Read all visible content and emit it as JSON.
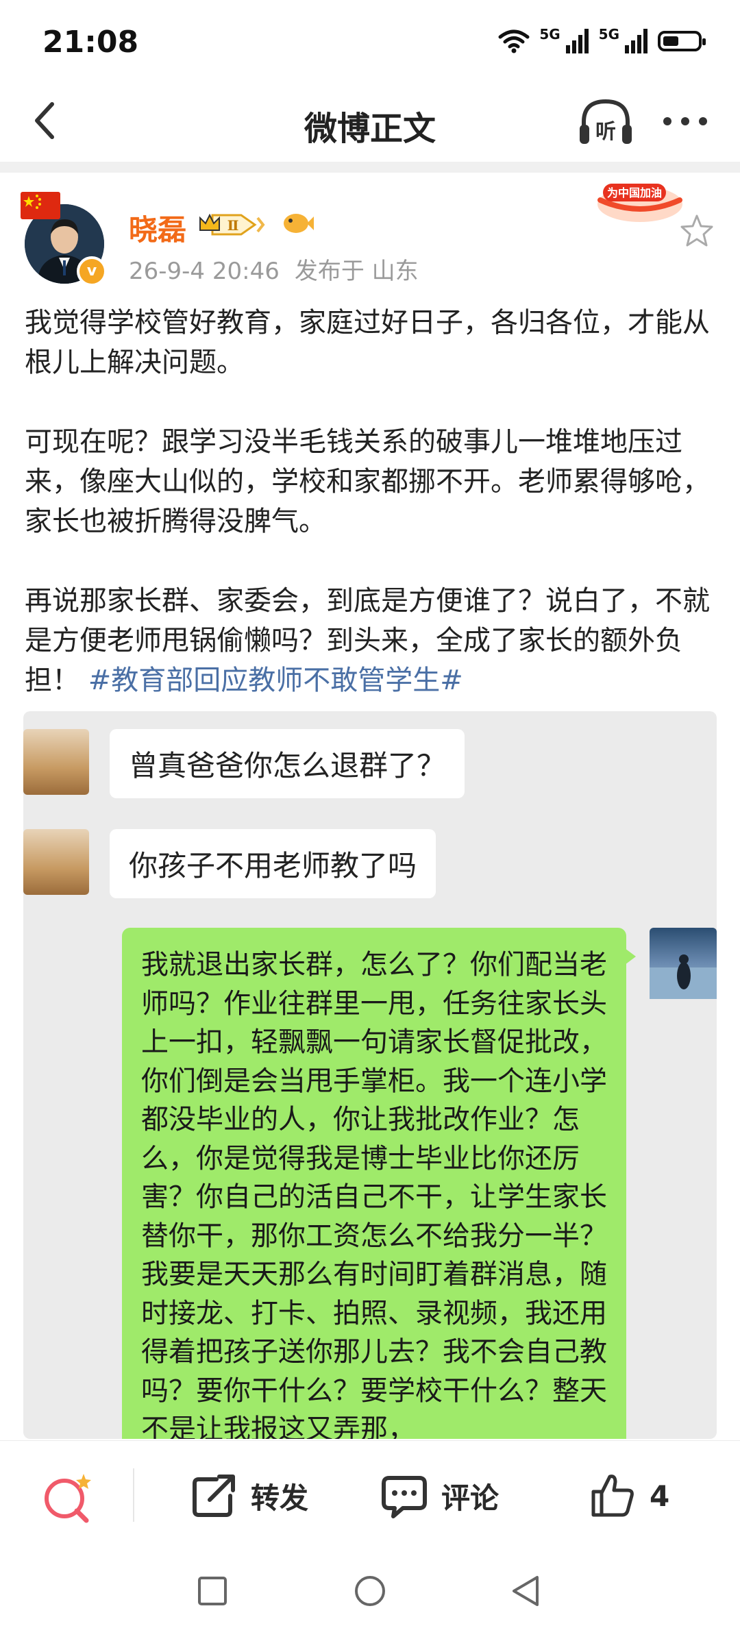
{
  "status_bar": {
    "time": "21:08",
    "network_1": "5G",
    "network_2": "5G",
    "battery_level": 0.45
  },
  "nav": {
    "title": "微博正文",
    "listen_label": "听"
  },
  "post": {
    "author": "晓磊",
    "level_badge": "Ⅱ",
    "verified_mark": "v",
    "timestamp": "26-9-4 20:46",
    "location": "发布于 山东",
    "promo_badge_text": "为中国加油",
    "paragraphs": [
      "我觉得学校管好教育，家庭过好日子，各归各位，才能从根儿上解决问题。",
      "可现在呢？跟学习没半毛钱关系的破事儿一堆堆地压过来，像座大山似的，学校和家都挪不开。老师累得够呛，家长也被折腾得没脾气。",
      "再说那家长群、家委会，到底是方便谁了？说白了，不就是方便老师甩锅偷懒吗？到头来，全成了家长的额外负担！"
    ],
    "hashtag": "#教育部回应教师不敢管学生#"
  },
  "chat_image": {
    "messages": [
      {
        "side": "left",
        "text": "曾真爸爸你怎么退群了？"
      },
      {
        "side": "left",
        "text": "你孩子不用老师教了吗"
      },
      {
        "side": "right",
        "text": "我就退出家长群，怎么了？你们配当老师吗？作业往群里一甩，任务往家长头上一扣，轻飘飘一句请家长督促批改，你们倒是会当甩手掌柜。我一个连小学都没毕业的人，你让我批改作业？怎么，你是觉得我是博士毕业比你还厉害？你自己的活自己不干，让学生家长替你干，那你工资怎么不给我分一半？我要是天天那么有时间盯着群消息，随时接龙、打卡、拍照、录视频，我还用得着把孩子送你那儿去？我不会自己教吗？要你干什么？要学校干什么？整天不是让我报这又弄那，"
      }
    ]
  },
  "actions": {
    "repost_label": "转发",
    "comment_label": "评论",
    "like_count": "4"
  },
  "colors": {
    "username": "#f26a18",
    "hashtag": "#4a6fa5",
    "chat_bubble_right": "#9fea6a",
    "chat_background": "#ebebeb"
  },
  "icons": [
    "wifi-icon",
    "signal-icon",
    "battery-icon",
    "back-icon",
    "headphones-icon",
    "more-icon",
    "star-icon",
    "discover-icon",
    "repost-icon",
    "comment-icon",
    "like-icon",
    "square-icon",
    "circle-icon",
    "triangle-back-icon"
  ]
}
